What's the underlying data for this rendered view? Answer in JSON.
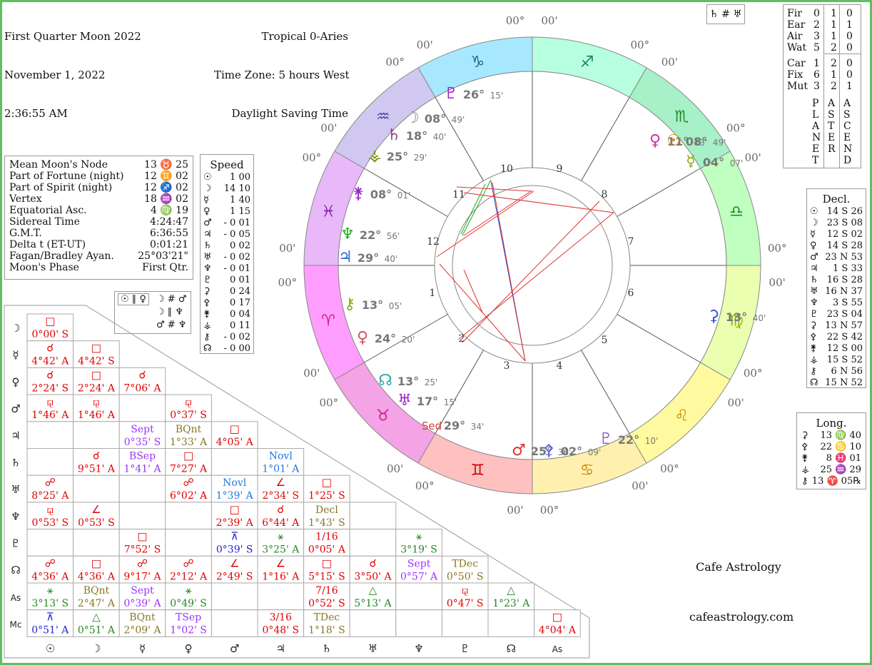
{
  "header": {
    "title": "First Quarter Moon 2022",
    "date": "November 1, 2022",
    "time": "2:36:55 AM",
    "zodiac": "Tropical 0-Aries",
    "timezone": "Time Zone: 5 hours West",
    "dst": "Daylight Saving Time"
  },
  "legend_box": "♄ # ♅",
  "elements": {
    "rows": [
      {
        "label": "Fir",
        "a": "0",
        "b": "1",
        "c": "0"
      },
      {
        "label": "Ear",
        "a": "2",
        "b": "1",
        "c": "1"
      },
      {
        "label": "Air",
        "a": "3",
        "b": "1",
        "c": "0"
      },
      {
        "label": "Wat",
        "a": "5",
        "b": "2",
        "c": "0"
      },
      {
        "label": "Car",
        "a": "1",
        "b": "2",
        "c": "0"
      },
      {
        "label": "Fix",
        "a": "6",
        "b": "1",
        "c": "0"
      },
      {
        "label": "Mut",
        "a": "3",
        "b": "2",
        "c": "1"
      }
    ],
    "col1": "PLANET",
    "col2": "ASTER",
    "col3": "ASCEND"
  },
  "info": [
    {
      "k": "Mean Moon's Node",
      "v": "13 ♉ 25"
    },
    {
      "k": "Part of Fortune (night)",
      "v": "12 ♊ 02"
    },
    {
      "k": "Part of Spirit (night)",
      "v": "12 ♐ 02"
    },
    {
      "k": "Vertex",
      "v": "18 ♒ 02"
    },
    {
      "k": "Equatorial Asc.",
      "v": "4 ♍ 19"
    },
    {
      "k": "Sidereal Time",
      "v": "4:24:47"
    },
    {
      "k": "G.M.T.",
      "v": "6:36:55"
    },
    {
      "k": "Delta t (ET-UT)",
      "v": "0:01:21"
    },
    {
      "k": "Fagan/Bradley Ayan.",
      "v": "25°03'21\""
    },
    {
      "k": "Moon's Phase",
      "v": "First Qtr."
    }
  ],
  "speed": {
    "title": "Speed",
    "rows": [
      {
        "s": "☉",
        "v": "1 00"
      },
      {
        "s": "☽",
        "v": "14 10"
      },
      {
        "s": "☿",
        "v": "1 40"
      },
      {
        "s": "♀",
        "v": "1 15"
      },
      {
        "s": "♂",
        "v": "- 0 01"
      },
      {
        "s": "♃",
        "v": "- 0 05"
      },
      {
        "s": "♄",
        "v": "0 02"
      },
      {
        "s": "♅",
        "v": "- 0 02"
      },
      {
        "s": "♆",
        "v": "- 0 01"
      },
      {
        "s": "♇",
        "v": "0 01"
      },
      {
        "s": "⚳",
        "v": "0 24"
      },
      {
        "s": "⚴",
        "v": "0 17"
      },
      {
        "s": "⚵",
        "v": "0 04"
      },
      {
        "s": "⚶",
        "v": "0 11"
      },
      {
        "s": "⚷",
        "v": "- 0 02"
      },
      {
        "s": "☊",
        "v": "- 0 00"
      }
    ]
  },
  "parallels": {
    "left": "☉ ∥ ♀",
    "r1": "☽ # ♂",
    "r2": "☽ ∥ ♆",
    "r3": "♂ # ♆"
  },
  "declination": {
    "title": "Decl.",
    "rows": [
      {
        "s": "☉",
        "v": "14 S 26"
      },
      {
        "s": "☽",
        "v": "23 S 08"
      },
      {
        "s": "☿",
        "v": "12 S 02"
      },
      {
        "s": "♀",
        "v": "14 S 28"
      },
      {
        "s": "♂",
        "v": "23 N 53"
      },
      {
        "s": "♃",
        "v": "1 S 33"
      },
      {
        "s": "♄",
        "v": "16 S 28"
      },
      {
        "s": "♅",
        "v": "16 N 37"
      },
      {
        "s": "♆",
        "v": "3 S 55"
      },
      {
        "s": "♇",
        "v": "23 S 04"
      },
      {
        "s": "⚳",
        "v": "13 N 57"
      },
      {
        "s": "⚴",
        "v": "22 S 42"
      },
      {
        "s": "⚵",
        "v": "12 S 00"
      },
      {
        "s": "⚶",
        "v": "15 S 52"
      },
      {
        "s": "⚷",
        "v": "6 N 56"
      },
      {
        "s": "☊",
        "v": "15 N 52"
      }
    ]
  },
  "longitude": {
    "title": "Long.",
    "rows": [
      {
        "s": "⚳",
        "v": "13 ♍ 40"
      },
      {
        "s": "⚴",
        "v": "22 ♋ 10"
      },
      {
        "s": "⚵",
        "v": "8 ♓ 01"
      },
      {
        "s": "⚶",
        "v": "25 ♒ 29"
      },
      {
        "s": "⚷",
        "v": "13 ♈ 05℞"
      }
    ]
  },
  "credits": {
    "name": "Cafe Astrology",
    "url": "cafeastrology.com"
  },
  "wheel": {
    "signs": [
      "♈",
      "♉",
      "♊",
      "♋",
      "♌",
      "♍",
      "♎",
      "♏",
      "♐",
      "♑",
      "♒",
      "♓"
    ],
    "sign_colors": [
      "#ff9eff",
      "#f4a3e6",
      "#ffc0c0",
      "#fff0b0",
      "#fffaa0",
      "#eaffb0",
      "#c0ffc0",
      "#a8f0c8",
      "#b8ffe0",
      "#a8e8ff",
      "#d0c8f0",
      "#e8b8f8"
    ],
    "sign_glyph_colors": [
      "#cc2288",
      "#cc2288",
      "#cc0000",
      "#cc8800",
      "#cc8800",
      "#99aa00",
      "#228822",
      "#228822",
      "#118866",
      "#116688",
      "#4444aa",
      "#8822aa"
    ],
    "cusp_deg": "00°",
    "cusp_min": "00'",
    "houses": [
      "1",
      "2",
      "3",
      "4",
      "5",
      "6",
      "7",
      "8",
      "9",
      "10",
      "11",
      "12"
    ],
    "house_labels": [
      {
        "g": "♃",
        "deg": "29°",
        "min": "40'"
      },
      {
        "g": "♆",
        "deg": "22°",
        "min": "56'"
      },
      {
        "g": "⚵",
        "deg": "08°",
        "min": "01'"
      },
      {
        "g": "⚷",
        "deg": "13°",
        "min": "05'"
      },
      {
        "g": "♀",
        "deg": "24°",
        "min": "20'"
      },
      {
        "g": "☊",
        "deg": "13°",
        "min": "25'"
      },
      {
        "g": "♅",
        "deg": "17°",
        "min": "15'"
      },
      {
        "g": "☽",
        "deg": "08°",
        "min": "49'"
      },
      {
        "g": "♄",
        "deg": "18°",
        "min": "40'"
      },
      {
        "g": "⚶",
        "deg": "25°",
        "min": "29'"
      },
      {
        "g": "♇",
        "deg": "26°",
        "min": "15'"
      },
      {
        "g": "♀",
        "deg": "11°",
        "min": "13'"
      },
      {
        "g": "☉",
        "deg": "08°",
        "min": "49'"
      },
      {
        "g": "☿",
        "deg": "04°",
        "min": "07'"
      },
      {
        "g": "⚳",
        "deg": "13°",
        "min": "40'"
      },
      {
        "g": "♂",
        "deg": "25°",
        "min": "36'"
      },
      {
        "g": "⚴",
        "deg": "02°",
        "min": "09'"
      },
      {
        "g": "♇",
        "deg": "22°",
        "min": "10'"
      },
      {
        "g": "Sed",
        "deg": "29°",
        "min": "34'"
      }
    ]
  },
  "aspect_grid": {
    "col_labels": [
      "☉",
      "☽",
      "☿",
      "♀",
      "♂",
      "♃",
      "♄",
      "♅",
      "♆",
      "♇",
      "☊",
      "As"
    ],
    "row_labels": [
      "☽",
      "☿",
      "♀",
      "♂",
      "♃",
      "♄",
      "♅",
      "♆",
      "♇",
      "☊",
      "As",
      "Mc"
    ],
    "cells": [
      [
        {
          "g": "□",
          "t": "0°00'  S",
          "c": "#e00000"
        }
      ],
      [
        {
          "g": "☌",
          "t": "4°42'  A",
          "c": "#e00000"
        },
        {
          "g": "□",
          "t": "4°42'  S",
          "c": "#e00000"
        }
      ],
      [
        {
          "g": "☌",
          "t": "2°24'  S",
          "c": "#e00000"
        },
        {
          "g": "□",
          "t": "2°24'  A",
          "c": "#e00000"
        },
        {
          "g": "☌",
          "t": "7°06'  A",
          "c": "#e00000"
        }
      ],
      [
        {
          "g": "⚼",
          "t": "1°46'  A",
          "c": "#e00000"
        },
        {
          "g": "⚼",
          "t": "1°46'  A",
          "c": "#e00000"
        },
        null,
        {
          "g": "⚼",
          "t": "0°37'  S",
          "c": "#e00000"
        }
      ],
      [
        null,
        null,
        {
          "g": "Sept",
          "t": "0°35'  S",
          "c": "#9933ff"
        },
        {
          "g": "BQnt",
          "t": "1°33'  A",
          "c": "#887722"
        },
        {
          "g": "□",
          "t": "4°05'  A",
          "c": "#e00000"
        }
      ],
      [
        null,
        {
          "g": "☌",
          "t": "9°51'  A",
          "c": "#e00000"
        },
        {
          "g": "BSep",
          "t": "1°41'  A",
          "c": "#9933ff"
        },
        {
          "g": "□",
          "t": "7°27'  A",
          "c": "#e00000"
        },
        null,
        {
          "g": "Novl",
          "t": "1°01'  A",
          "c": "#2277dd"
        }
      ],
      [
        {
          "g": "☍",
          "t": "8°25'  A",
          "c": "#e00000"
        },
        null,
        null,
        {
          "g": "☍",
          "t": "6°02'  A",
          "c": "#e00000"
        },
        {
          "g": "Novl",
          "t": "1°39'  A",
          "c": "#2277dd"
        },
        {
          "g": "∠",
          "t": "2°34'  S",
          "c": "#e00000"
        },
        {
          "g": "□",
          "t": "1°25'  S",
          "c": "#e00000"
        }
      ],
      [
        {
          "g": "⚼",
          "t": "0°53'  S",
          "c": "#e00000"
        },
        {
          "g": "∠",
          "t": "0°53'  S",
          "c": "#e00000"
        },
        null,
        null,
        {
          "g": "□",
          "t": "2°39'  A",
          "c": "#e00000"
        },
        {
          "g": "☌",
          "t": "6°44'  A",
          "c": "#e00000"
        },
        {
          "g": "Decl",
          "t": "1°43'  S",
          "c": "#887722"
        }
      ],
      [
        null,
        null,
        {
          "g": "□",
          "t": "7°52'  S",
          "c": "#e00000"
        },
        null,
        {
          "g": "⊼",
          "t": "0°39'  S",
          "c": "#2222cc"
        },
        {
          "g": "⚹",
          "t": "3°25'  A",
          "c": "#228822"
        },
        {
          "g": "1/16",
          "t": "0°05'  A",
          "c": "#e00000"
        },
        null,
        {
          "g": "⚹",
          "t": "3°19'  S",
          "c": "#228822"
        }
      ],
      [
        {
          "g": "☍",
          "t": "4°36'  A",
          "c": "#e00000"
        },
        {
          "g": "□",
          "t": "4°36'  A",
          "c": "#e00000"
        },
        {
          "g": "☍",
          "t": "9°17'  A",
          "c": "#e00000"
        },
        {
          "g": "☍",
          "t": "2°12'  A",
          "c": "#e00000"
        },
        {
          "g": "∠",
          "t": "2°49'  S",
          "c": "#e00000"
        },
        {
          "g": "∠",
          "t": "1°16'  A",
          "c": "#e00000"
        },
        {
          "g": "□",
          "t": "5°15'  S",
          "c": "#e00000"
        },
        {
          "g": "☌",
          "t": "3°50'  A",
          "c": "#e00000"
        },
        {
          "g": "Sept",
          "t": "0°57'  A",
          "c": "#9933ff"
        },
        {
          "g": "TDec",
          "t": "0°50'  S",
          "c": "#887722"
        }
      ],
      [
        {
          "g": "⚹",
          "t": "3°13'  S",
          "c": "#228822"
        },
        {
          "g": "BQnt",
          "t": "2°47'  A",
          "c": "#887722"
        },
        {
          "g": "Sept",
          "t": "0°39'  A",
          "c": "#9933ff"
        },
        {
          "g": "⚹",
          "t": "0°49'  S",
          "c": "#228822"
        },
        null,
        null,
        {
          "g": "7/16",
          "t": "0°52'  S",
          "c": "#e00000"
        },
        {
          "g": "△",
          "t": "5°13'  A",
          "c": "#228822"
        },
        null,
        {
          "g": "⚼",
          "t": "0°47'  S",
          "c": "#e00000"
        },
        {
          "g": "△",
          "t": "1°23'  A",
          "c": "#228822"
        }
      ],
      [
        {
          "g": "⊼",
          "t": "0°51'  A",
          "c": "#2222cc"
        },
        {
          "g": "△",
          "t": "0°51'  A",
          "c": "#228822"
        },
        {
          "g": "BQnt",
          "t": "2°09'  A",
          "c": "#887722"
        },
        {
          "g": "TSep",
          "t": "1°02'  S",
          "c": "#9933ff"
        },
        null,
        {
          "g": "3/16",
          "t": "0°48'  S",
          "c": "#e00000"
        },
        {
          "g": "TDec",
          "t": "1°18'  S",
          "c": "#887722"
        },
        null,
        null,
        null,
        null,
        {
          "g": "□",
          "t": "4°04'  A",
          "c": "#e00000"
        }
      ]
    ]
  }
}
